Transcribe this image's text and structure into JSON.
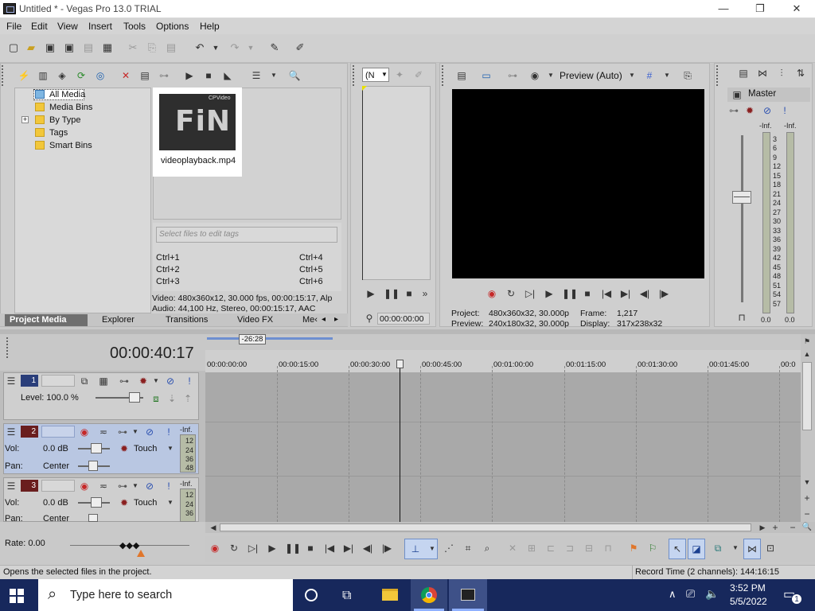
{
  "window": {
    "title": "Untitled * - Vegas Pro 13.0 TRIAL",
    "min": "—",
    "max": "❐",
    "close": "✕"
  },
  "menu": [
    "File",
    "Edit",
    "View",
    "Insert",
    "Tools",
    "Options",
    "Help"
  ],
  "explorer": {
    "tree": [
      {
        "label": "All Media"
      },
      {
        "label": "Media Bins"
      },
      {
        "label": "By Type",
        "expander": "+"
      },
      {
        "label": "Tags"
      },
      {
        "label": "Smart Bins"
      }
    ],
    "media": {
      "filename": "videoplayback.mp4",
      "thumb_text": "FiN",
      "thumb_sub": "CPVideo"
    },
    "tag_input_placeholder": "Select files to edit tags",
    "shortcuts": [
      "Ctrl+1",
      "Ctrl+4",
      "Ctrl+2",
      "Ctrl+5",
      "Ctrl+3",
      "Ctrl+6"
    ],
    "info_video": "Video: 480x360x12, 30.000 fps, 00:00:15:17, Alp",
    "info_audio": "Audio: 44,100 Hz, Stereo, 00:00:15:17, AAC",
    "tabs": [
      "Project Media",
      "Explorer",
      "Transitions",
      "Video FX",
      "Me‹"
    ]
  },
  "trimmer": {
    "select": "(N",
    "timecode": "00:00:00:00"
  },
  "preview": {
    "mode": "Preview (Auto)",
    "project_label": "Project:",
    "project_value": "480x360x32, 30.000p",
    "preview_label": "Preview:",
    "preview_value": "240x180x32, 30.000p",
    "frame_label": "Frame:",
    "frame_value": "1,217",
    "display_label": "Display:",
    "display_value": "317x238x32"
  },
  "mixer": {
    "title": "Master",
    "inf_left": "-Inf.",
    "inf_right": "-Inf.",
    "scale": [
      "3",
      "6",
      "9",
      "12",
      "15",
      "18",
      "21",
      "24",
      "27",
      "30",
      "33",
      "36",
      "39",
      "42",
      "45",
      "48",
      "51",
      "54",
      "57"
    ],
    "zero_left": "0.0",
    "zero_right": "0.0"
  },
  "timeline": {
    "timecode": "00:00:40:17",
    "loop_length": "-26:28",
    "ruler": [
      "00:00:00:00",
      "00:00:15:00",
      "00:00:30:00",
      "00:00:45:00",
      "00:01:00:00",
      "00:01:15:00",
      "00:01:30:00",
      "00:01:45:00",
      "00:0"
    ],
    "tracks": [
      {
        "num": "1",
        "level_label": "Level: 100.0 %"
      },
      {
        "num": "2",
        "vol_label": "Vol:",
        "vol_value": "0.0 dB",
        "pan_label": "Pan:",
        "pan_value": "Center",
        "mode": "Touch",
        "inf": "-Inf.",
        "meter": [
          "12",
          "24",
          "36",
          "48"
        ]
      },
      {
        "num": "3",
        "vol_label": "Vol:",
        "vol_value": "0.0 dB",
        "pan_label": "Pan:",
        "pan_value": "Center",
        "mode": "Touch",
        "inf": "-Inf.",
        "meter": [
          "12",
          "24",
          "36"
        ]
      }
    ],
    "rate": "Rate: 0.00"
  },
  "status": {
    "left": "Opens the selected files in the project.",
    "right": "Record Time (2 channels): 144:16:15"
  },
  "taskbar": {
    "search": "Type here to search",
    "time": "3:52 PM",
    "date": "5/5/2022",
    "notif": "1"
  }
}
